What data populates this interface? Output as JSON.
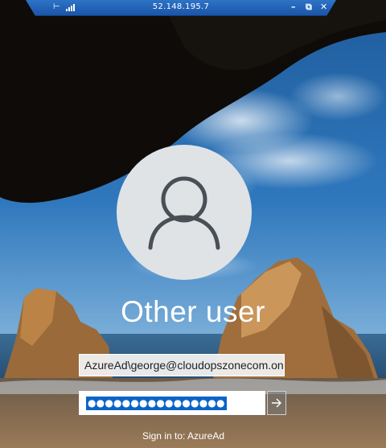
{
  "rdp_bar": {
    "ip": "52.148.195.7",
    "icons": [
      "pin-icon",
      "signal-icon",
      "minimize-icon",
      "restore-icon",
      "close-icon"
    ]
  },
  "login": {
    "user_name": "Other user",
    "username_value": "AzureAd\\george@cloudopszonecom.onm",
    "password_dots": "●●●●●●●●●●●●●●●●",
    "submit_icon": "arrow-right-icon",
    "sign_in_to": "Sign in to: AzureAd"
  },
  "colors": {
    "rdp_bar": "#1b55a8",
    "password_highlight": "#0a64c8",
    "avatar_circle": "#dfe3e6"
  }
}
